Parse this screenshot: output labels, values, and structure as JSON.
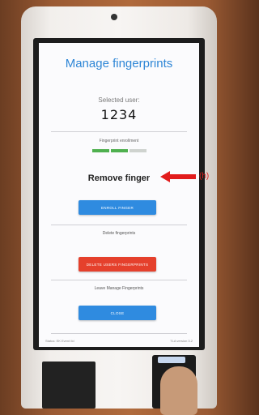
{
  "screen": {
    "title": "Manage fingerprints",
    "selected_user_label": "Selected user:",
    "selected_user_value": "1234",
    "enrollment_label": "Fingerprint enrollment",
    "enrollment_progress": {
      "completed_segments": 2,
      "total_segments": 3
    },
    "status_message": "Remove finger",
    "enroll_button_label": "ENROLL FINGER",
    "delete_section_label": "Delete fingerprints",
    "delete_button_label": "DELETE USERS FINGERPRINTS",
    "leave_section_label": "Leave Manage Fingerprints",
    "close_button_label": "CLOSE",
    "footer_left": "Status: EK Event Ild",
    "footer_right": "TLA version 3.2"
  },
  "annotation": {
    "label": "(h)",
    "color": "#e21c1c"
  },
  "colors": {
    "accent_blue": "#2e86d6",
    "button_blue": "#2f8be0",
    "button_red": "#e5402c",
    "progress_green": "#4fb04f"
  }
}
